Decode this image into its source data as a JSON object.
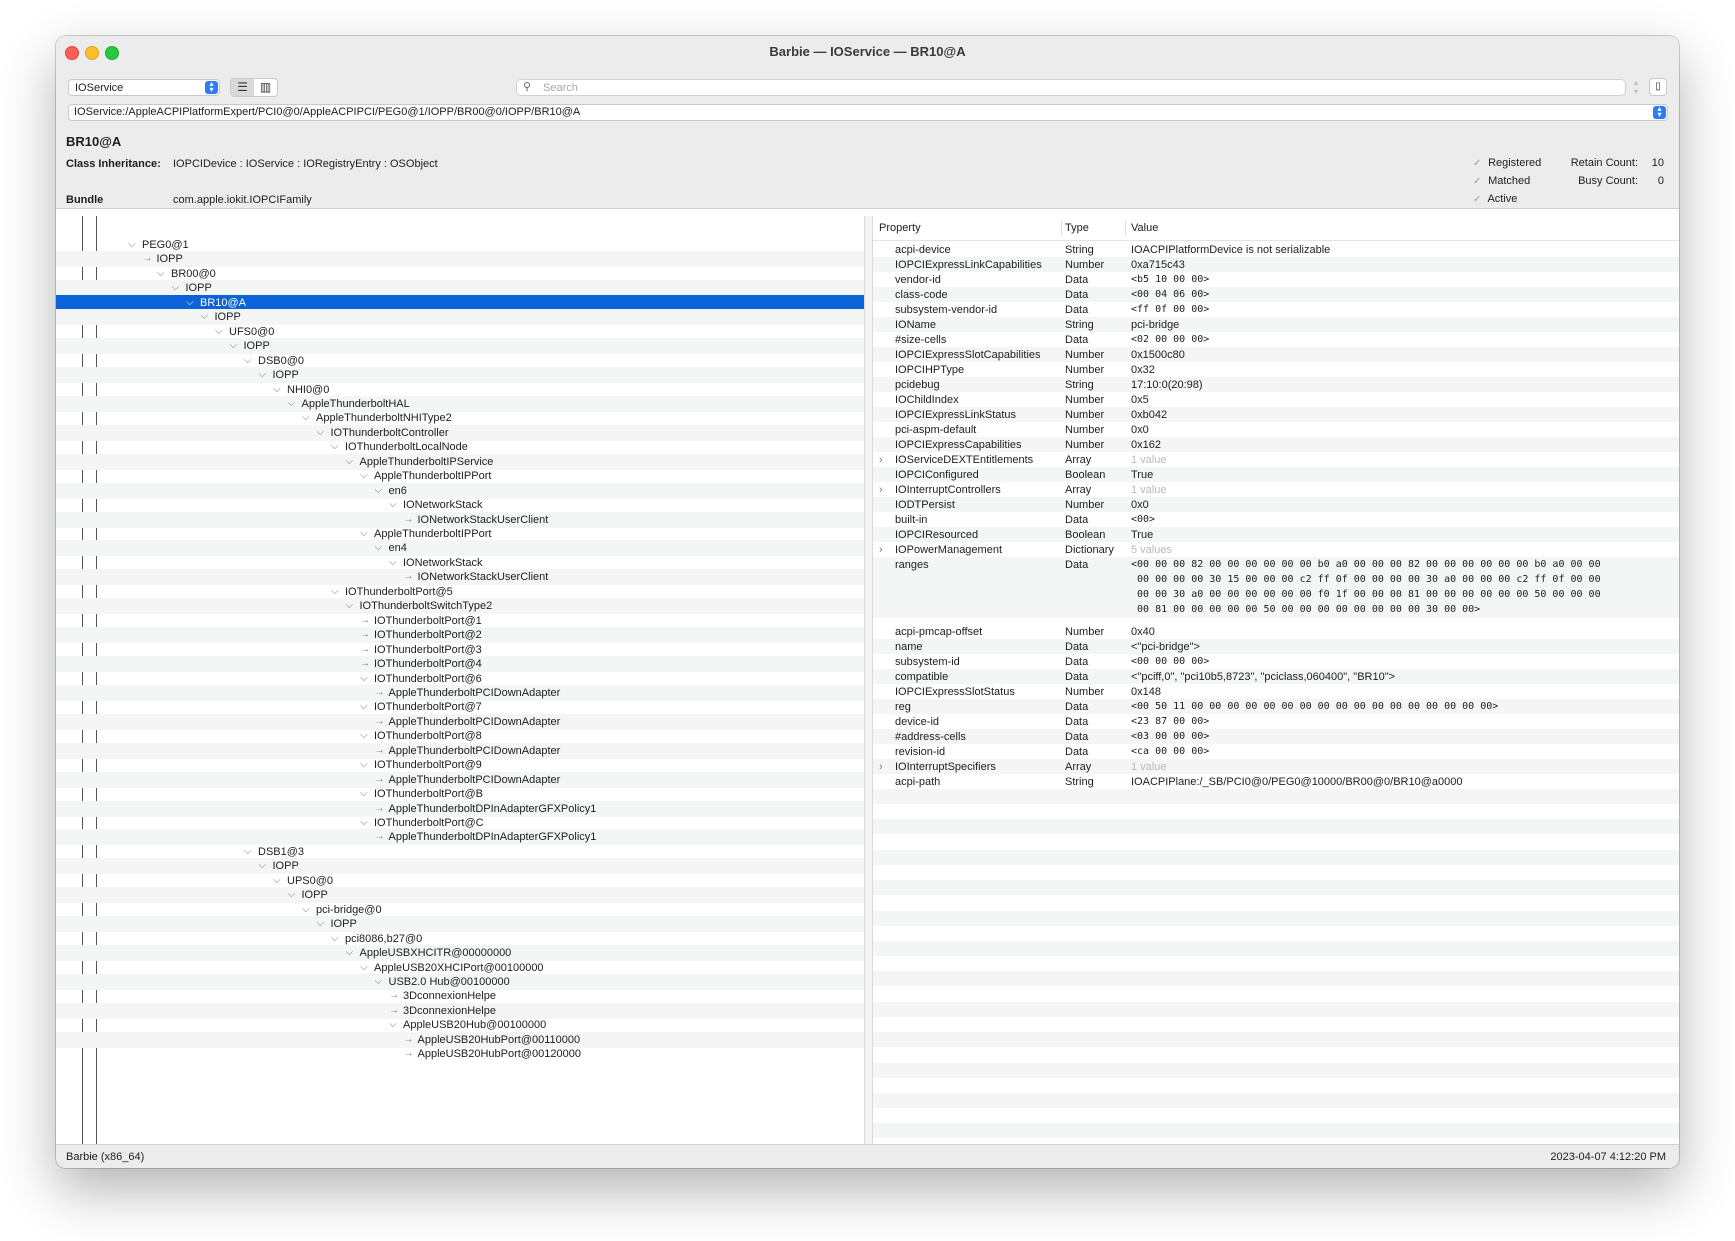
{
  "window": {
    "title": "Barbie — IOService — BR10@A"
  },
  "toolbar": {
    "plane": "IOService",
    "view_list_icon": "list-view-icon",
    "view_column_icon": "column-view-icon",
    "search_placeholder": "Search",
    "path": "IOService:/AppleACPIPlatformExpert/PCI0@0/AppleACPIPCI/PEG0@1/IOPP/BR00@0/IOPP/BR10@A"
  },
  "info": {
    "name": "BR10@A",
    "class_label": "Class Inheritance:",
    "class_value": "IOPCIDevice : IOService : IORegistryEntry : OSObject",
    "bundle_label": "Bundle",
    "bundle_value": "com.apple.iokit.IOPCIFamily",
    "flags": [
      "Registered",
      "Matched",
      "Active"
    ],
    "retain_label": "Retain Count:",
    "retain_value": "10",
    "busy_label": "Busy Count:",
    "busy_value": "0"
  },
  "tree": {
    "rows": [
      {
        "label": "PEG0@1",
        "depth": 0,
        "tw": "v"
      },
      {
        "label": "IOPP",
        "depth": 1,
        "tw": ""
      },
      {
        "label": "BR00@0",
        "depth": 2,
        "tw": "v"
      },
      {
        "label": "IOPP",
        "depth": 3,
        "tw": "v"
      },
      {
        "label": "BR10@A",
        "depth": 4,
        "tw": "v",
        "selected": true
      },
      {
        "label": "IOPP",
        "depth": 5,
        "tw": "v"
      },
      {
        "label": "UFS0@0",
        "depth": 6,
        "tw": "v"
      },
      {
        "label": "IOPP",
        "depth": 7,
        "tw": "v"
      },
      {
        "label": "DSB0@0",
        "depth": 8,
        "tw": "v"
      },
      {
        "label": "IOPP",
        "depth": 9,
        "tw": "v"
      },
      {
        "label": "NHI0@0",
        "depth": 10,
        "tw": "v"
      },
      {
        "label": "AppleThunderboltHAL",
        "depth": 11,
        "tw": "v"
      },
      {
        "label": "AppleThunderboltNHIType2",
        "depth": 12,
        "tw": "v"
      },
      {
        "label": "IOThunderboltController",
        "depth": 13,
        "tw": "v"
      },
      {
        "label": "IOThunderboltLocalNode",
        "depth": 14,
        "tw": "v"
      },
      {
        "label": "AppleThunderboltIPService",
        "depth": 15,
        "tw": "v"
      },
      {
        "label": "AppleThunderboltIPPort",
        "depth": 16,
        "tw": "v"
      },
      {
        "label": "en6",
        "depth": 17,
        "tw": "v"
      },
      {
        "label": "IONetworkStack",
        "depth": 18,
        "tw": "v"
      },
      {
        "label": "IONetworkStackUserClient",
        "depth": 19,
        "tw": ""
      },
      {
        "label": "AppleThunderboltIPPort",
        "depth": 16,
        "tw": "v"
      },
      {
        "label": "en4",
        "depth": 17,
        "tw": "v"
      },
      {
        "label": "IONetworkStack",
        "depth": 18,
        "tw": "v"
      },
      {
        "label": "IONetworkStackUserClient",
        "depth": 19,
        "tw": ""
      },
      {
        "label": "IOThunderboltPort@5",
        "depth": 14,
        "tw": "v"
      },
      {
        "label": "IOThunderboltSwitchType2",
        "depth": 15,
        "tw": "v"
      },
      {
        "label": "IOThunderboltPort@1",
        "depth": 16,
        "tw": ""
      },
      {
        "label": "IOThunderboltPort@2",
        "depth": 16,
        "tw": ""
      },
      {
        "label": "IOThunderboltPort@3",
        "depth": 16,
        "tw": ""
      },
      {
        "label": "IOThunderboltPort@4",
        "depth": 16,
        "tw": ""
      },
      {
        "label": "IOThunderboltPort@6",
        "depth": 16,
        "tw": "v"
      },
      {
        "label": "AppleThunderboltPCIDownAdapter",
        "depth": 17,
        "tw": ""
      },
      {
        "label": "IOThunderboltPort@7",
        "depth": 16,
        "tw": "v"
      },
      {
        "label": "AppleThunderboltPCIDownAdapter",
        "depth": 17,
        "tw": ""
      },
      {
        "label": "IOThunderboltPort@8",
        "depth": 16,
        "tw": "v"
      },
      {
        "label": "AppleThunderboltPCIDownAdapter",
        "depth": 17,
        "tw": ""
      },
      {
        "label": "IOThunderboltPort@9",
        "depth": 16,
        "tw": "v"
      },
      {
        "label": "AppleThunderboltPCIDownAdapter",
        "depth": 17,
        "tw": ""
      },
      {
        "label": "IOThunderboltPort@B",
        "depth": 16,
        "tw": "v"
      },
      {
        "label": "AppleThunderboltDPInAdapterGFXPolicy1",
        "depth": 17,
        "tw": ""
      },
      {
        "label": "IOThunderboltPort@C",
        "depth": 16,
        "tw": "v"
      },
      {
        "label": "AppleThunderboltDPInAdapterGFXPolicy1",
        "depth": 17,
        "tw": ""
      },
      {
        "label": "DSB1@3",
        "depth": 8,
        "tw": "v"
      },
      {
        "label": "IOPP",
        "depth": 9,
        "tw": "v"
      },
      {
        "label": "UPS0@0",
        "depth": 10,
        "tw": "v"
      },
      {
        "label": "IOPP",
        "depth": 11,
        "tw": "v"
      },
      {
        "label": "pci-bridge@0",
        "depth": 12,
        "tw": "v"
      },
      {
        "label": "IOPP",
        "depth": 13,
        "tw": "v"
      },
      {
        "label": "pci8086,b27@0",
        "depth": 14,
        "tw": "v"
      },
      {
        "label": "AppleUSBXHCITR@00000000",
        "depth": 15,
        "tw": "v"
      },
      {
        "label": "AppleUSB20XHCIPort@00100000",
        "depth": 16,
        "tw": "v"
      },
      {
        "label": "USB2.0 Hub@00100000",
        "depth": 17,
        "tw": "v"
      },
      {
        "label": "3DconnexionHelpe",
        "depth": 18,
        "tw": ""
      },
      {
        "label": "3DconnexionHelpe",
        "depth": 18,
        "tw": ""
      },
      {
        "label": "AppleUSB20Hub@00100000",
        "depth": 18,
        "tw": "v"
      },
      {
        "label": "AppleUSB20HubPort@00110000",
        "depth": 19,
        "tw": ""
      },
      {
        "label": "AppleUSB20HubPort@00120000",
        "depth": 19,
        "tw": ""
      }
    ]
  },
  "properties": {
    "headers": {
      "property": "Property",
      "type": "Type",
      "value": "Value"
    },
    "rows": [
      {
        "name": "acpi-device",
        "type": "String",
        "value": "IOACPIPlatformDevice is not serializable"
      },
      {
        "name": "IOPCIExpressLinkCapabilities",
        "type": "Number",
        "value": "0xa715c43"
      },
      {
        "name": "vendor-id",
        "type": "Data",
        "value": "<b5 10 00 00>",
        "mono": true
      },
      {
        "name": "class-code",
        "type": "Data",
        "value": "<00 04 06 00>",
        "mono": true
      },
      {
        "name": "subsystem-vendor-id",
        "type": "Data",
        "value": "<ff 0f 00 00>",
        "mono": true
      },
      {
        "name": "IOName",
        "type": "String",
        "value": "pci-bridge"
      },
      {
        "name": "#size-cells",
        "type": "Data",
        "value": "<02 00 00 00>",
        "mono": true
      },
      {
        "name": "IOPCIExpressSlotCapabilities",
        "type": "Number",
        "value": "0x1500c80"
      },
      {
        "name": "IOPCIHPType",
        "type": "Number",
        "value": "0x32"
      },
      {
        "name": "pcidebug",
        "type": "String",
        "value": "17:10:0(20:98)"
      },
      {
        "name": "IOChildIndex",
        "type": "Number",
        "value": "0x5"
      },
      {
        "name": "IOPCIExpressLinkStatus",
        "type": "Number",
        "value": "0xb042"
      },
      {
        "name": "pci-aspm-default",
        "type": "Number",
        "value": "0x0"
      },
      {
        "name": "IOPCIExpressCapabilities",
        "type": "Number",
        "value": "0x162"
      },
      {
        "name": "IOServiceDEXTEntitlements",
        "type": "Array",
        "value": "1 value",
        "dim": true,
        "disclosure": true
      },
      {
        "name": "IOPCIConfigured",
        "type": "Boolean",
        "value": "True"
      },
      {
        "name": "IOInterruptControllers",
        "type": "Array",
        "value": "1 value",
        "dim": true,
        "disclosure": true
      },
      {
        "name": "IODTPersist",
        "type": "Number",
        "value": "0x0"
      },
      {
        "name": "built-in",
        "type": "Data",
        "value": "<00>",
        "mono": true
      },
      {
        "name": "IOPCIResourced",
        "type": "Boolean",
        "value": "True"
      },
      {
        "name": "IOPowerManagement",
        "type": "Dictionary",
        "value": "5 values",
        "dim": true,
        "disclosure": true
      },
      {
        "name": "ranges",
        "type": "Data",
        "mono": true,
        "value": "<00 00 00 82 00 00 00 00 00 00 b0 a0 00 00 00 82 00 00 00 00 00 00 b0 a0 00 00\n 00 00 00 00 30 15 00 00 00 c2 ff 0f 00 00 00 00 30 a0 00 00 00 c2 ff 0f 00 00\n 00 00 30 a0 00 00 00 00 00 00 f0 1f 00 00 00 81 00 00 00 00 00 00 50 00 00 00\n 00 81 00 00 00 00 00 50 00 00 00 00 00 00 00 00 30 00 00>"
      },
      {
        "name": "acpi-pmcap-offset",
        "type": "Number",
        "value": "0x40"
      },
      {
        "name": "name",
        "type": "Data",
        "value": "<\"pci-bridge\">"
      },
      {
        "name": "subsystem-id",
        "type": "Data",
        "value": "<00 00 00 00>",
        "mono": true
      },
      {
        "name": "compatible",
        "type": "Data",
        "value": "<\"pciff,0\", \"pci10b5,8723\", \"pciclass,060400\", \"BR10\">"
      },
      {
        "name": "IOPCIExpressSlotStatus",
        "type": "Number",
        "value": "0x148"
      },
      {
        "name": "reg",
        "type": "Data",
        "value": "<00 50 11 00 00 00 00 00 00 00 00 00 00 00 00 00 00 00 00 00>",
        "mono": true
      },
      {
        "name": "device-id",
        "type": "Data",
        "value": "<23 87 00 00>",
        "mono": true
      },
      {
        "name": "#address-cells",
        "type": "Data",
        "value": "<03 00 00 00>",
        "mono": true
      },
      {
        "name": "revision-id",
        "type": "Data",
        "value": "<ca 00 00 00>",
        "mono": true
      },
      {
        "name": "IOInterruptSpecifiers",
        "type": "Array",
        "value": "1 value",
        "dim": true,
        "disclosure": true
      },
      {
        "name": "acpi-path",
        "type": "String",
        "value": "IOACPIPlane:/_SB/PCI0@0/PEG0@10000/BR00@0/BR10@a0000"
      }
    ]
  },
  "status": {
    "left": "Barbie (x86_64)",
    "right": "2023-04-07 4:12:20 PM"
  },
  "colors": {
    "selection": "#0a63d8",
    "close": "#fe5f57",
    "minimize": "#febc2e",
    "zoom": "#28c840"
  }
}
